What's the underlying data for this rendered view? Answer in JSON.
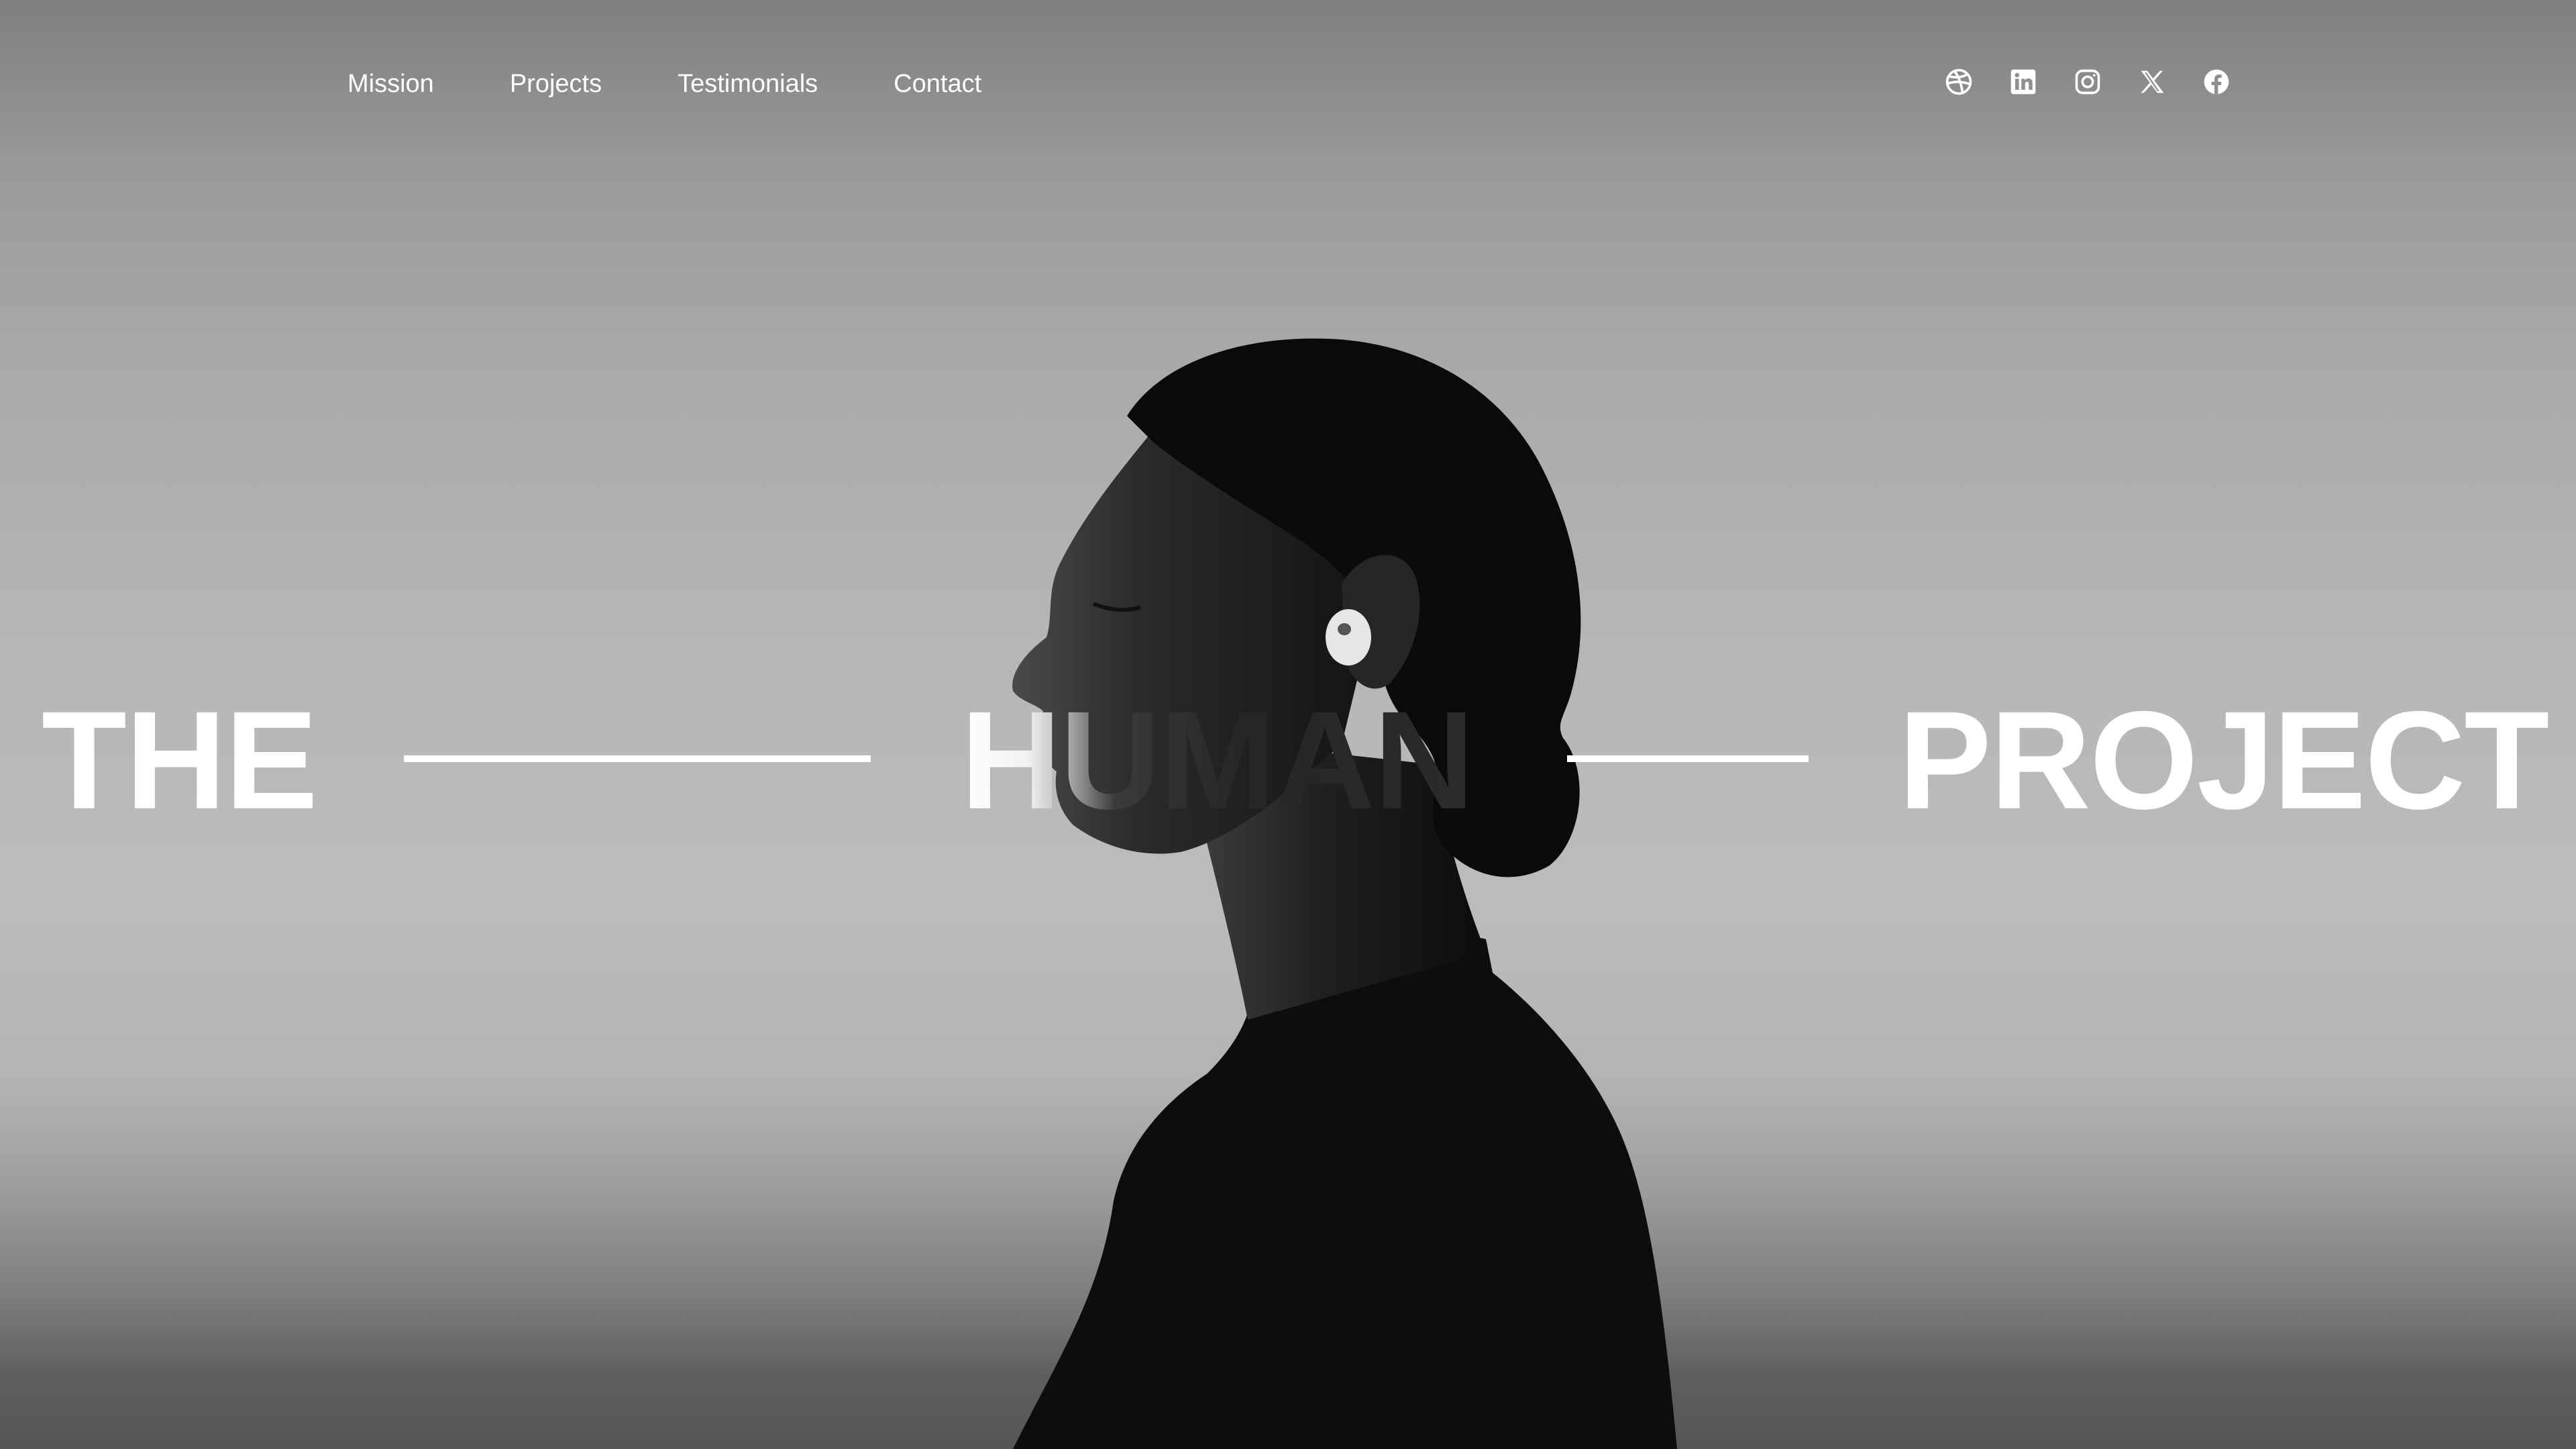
{
  "nav": {
    "items": [
      {
        "label": "Mission"
      },
      {
        "label": "Projects"
      },
      {
        "label": "Testimonials"
      },
      {
        "label": "Contact"
      }
    ]
  },
  "socials": [
    {
      "icon": "dribbble-icon"
    },
    {
      "icon": "linkedin-icon"
    },
    {
      "icon": "instagram-icon"
    },
    {
      "icon": "x-icon"
    },
    {
      "icon": "facebook-icon"
    }
  ],
  "hero": {
    "words": [
      "THE",
      "HUMAN",
      "PROJECT"
    ]
  },
  "colors": {
    "text": "#ffffff",
    "figure": "#0e0e0e",
    "background": "#b6b6b6"
  }
}
